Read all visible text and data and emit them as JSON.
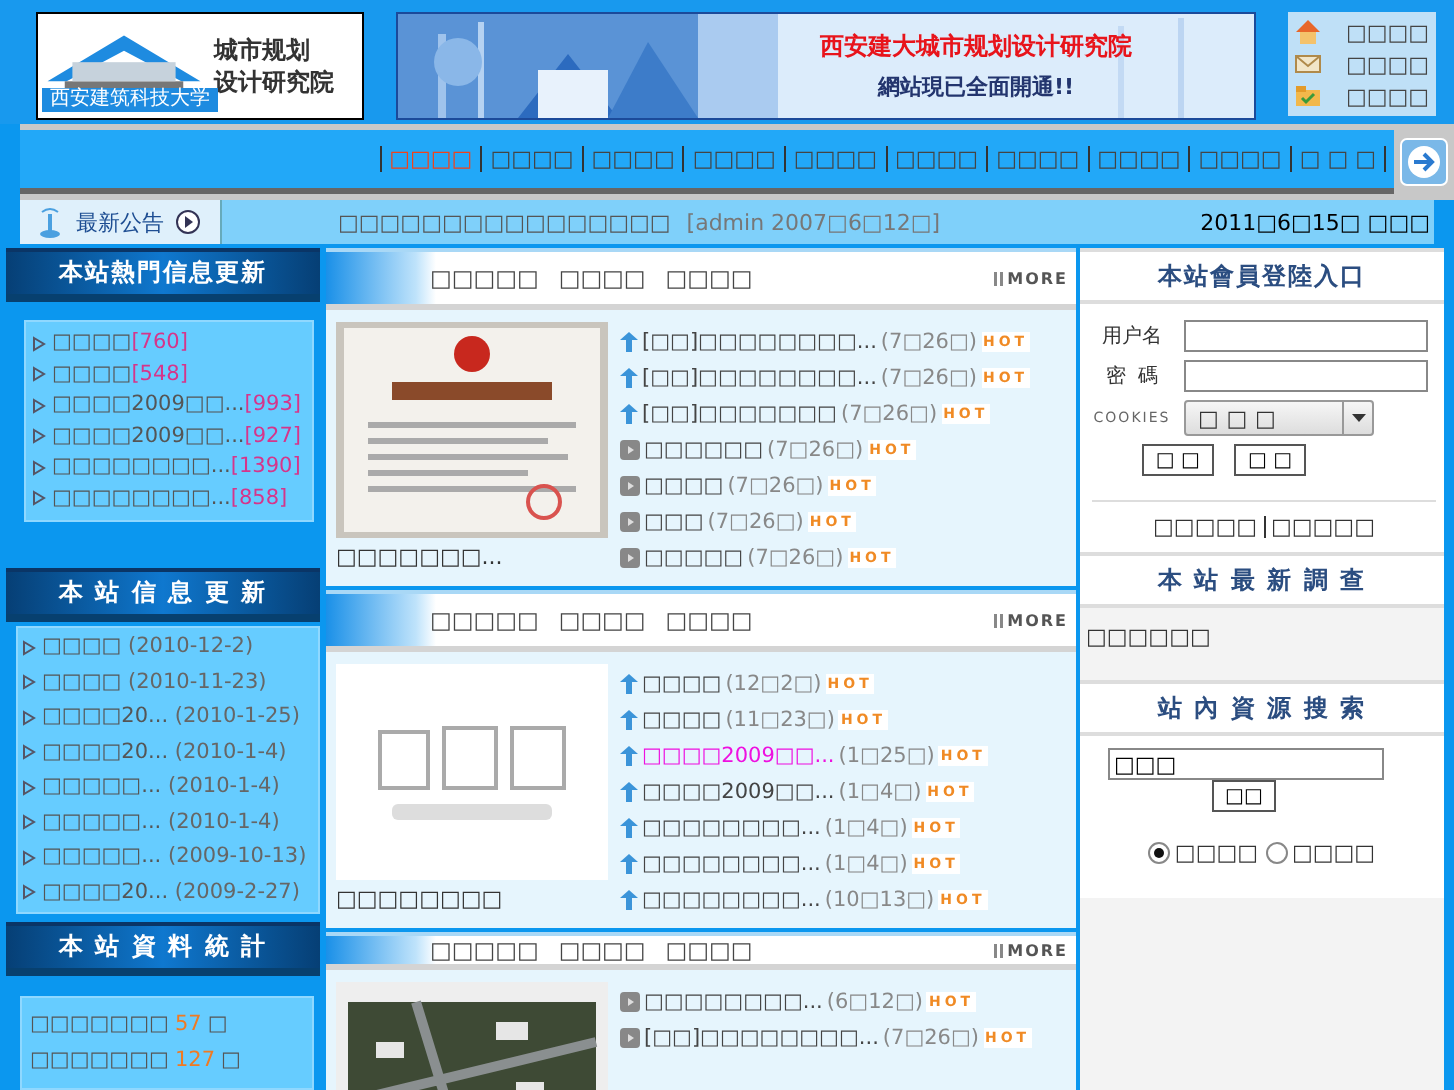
{
  "header": {
    "logo": {
      "title_line1": "城市规划",
      "title_line2": "设计研究院",
      "university": "西安建筑科技大学"
    },
    "banner": {
      "headline": "西安建大城市规划设计研究院",
      "subline": "網站現已全面開通!!"
    },
    "quick_links": [
      {
        "kind": "home",
        "label": "□□□□"
      },
      {
        "kind": "mail",
        "label": "□□□□"
      },
      {
        "kind": "bookmark",
        "label": "□□□□"
      }
    ]
  },
  "nav": {
    "items": [
      {
        "label": "□□□□",
        "selected": true
      },
      {
        "label": "□□□□",
        "selected": false
      },
      {
        "label": "□□□□",
        "selected": false
      },
      {
        "label": "□□□□",
        "selected": false
      },
      {
        "label": "□□□□",
        "selected": false
      },
      {
        "label": "□□□□",
        "selected": false
      },
      {
        "label": "□□□□",
        "selected": false
      },
      {
        "label": "□□□□",
        "selected": false
      },
      {
        "label": "□□□□",
        "selected": false
      },
      {
        "label": "□ □ □",
        "selected": false
      }
    ]
  },
  "notice": {
    "label": "最新公告",
    "text": "□□□□□□□□□□□□□□□□",
    "meta": "[admin  2007□6□12□]",
    "date": "2011□6□15□ □□□"
  },
  "sidebar": {
    "hot": {
      "title": "本站熱門信息更新",
      "items": [
        {
          "title": "□□□□",
          "count": "[760]"
        },
        {
          "title": "□□□□",
          "count": "[548]"
        },
        {
          "title": "□□□□2009□□...",
          "count": "[993]"
        },
        {
          "title": "□□□□2009□□...",
          "count": "[927]"
        },
        {
          "title": "□□□□□□□□...",
          "count": "[1390]"
        },
        {
          "title": "□□□□□□□□...",
          "count": "[858]"
        }
      ]
    },
    "updates": {
      "title": "本 站 信 息 更 新",
      "items": [
        {
          "title": "□□□□",
          "date": "(2010-12-2)"
        },
        {
          "title": "□□□□",
          "date": "(2010-11-23)"
        },
        {
          "title": "□□□□20...",
          "date": "(2010-1-25)"
        },
        {
          "title": "□□□□20...",
          "date": "(2010-1-4)"
        },
        {
          "title": "□□□□□...",
          "date": "(2010-1-4)"
        },
        {
          "title": "□□□□□...",
          "date": "(2010-1-4)"
        },
        {
          "title": "□□□□□...",
          "date": "(2009-10-13)"
        },
        {
          "title": "□□□□20...",
          "date": "(2009-2-27)"
        }
      ]
    },
    "stats": {
      "title": "本 站 資 料 統 計",
      "rows": [
        {
          "label": "□□□□□□□",
          "value": "57",
          "unit": "□"
        },
        {
          "label": "□□□□□□□",
          "value": "127",
          "unit": "□"
        }
      ]
    }
  },
  "panels": [
    {
      "tabs": [
        "□□□□□",
        "□□□□",
        "□□□□"
      ],
      "more": "MORE",
      "caption": "□□□□□□□...",
      "items": [
        {
          "kind": "up",
          "title": "[□□]□□□□□□□□...",
          "date": "(7□26□)",
          "tag": "HOT",
          "highlighted": false
        },
        {
          "kind": "up",
          "title": "[□□]□□□□□□□□...",
          "date": "(7□26□)",
          "tag": "HOT",
          "highlighted": false
        },
        {
          "kind": "up",
          "title": "[□□]□□□□□□□",
          "date": "(7□26□)",
          "tag": "HOT",
          "highlighted": false
        },
        {
          "kind": "square",
          "title": "□□□□□□",
          "date": "(7□26□)",
          "tag": "HOT",
          "highlighted": false
        },
        {
          "kind": "square",
          "title": "□□□□",
          "date": "(7□26□)",
          "tag": "HOT",
          "highlighted": false
        },
        {
          "kind": "square",
          "title": "□□□",
          "date": "(7□26□)",
          "tag": "HOT",
          "highlighted": false
        },
        {
          "kind": "square",
          "title": "□□□□□",
          "date": "(7□26□)",
          "tag": "HOT",
          "highlighted": false
        }
      ]
    },
    {
      "tabs": [
        "□□□□□",
        "□□□□",
        "□□□□"
      ],
      "more": "MORE",
      "caption": "□□□□□□□□",
      "items": [
        {
          "kind": "up",
          "title": "□□□□",
          "date": "(12□2□)",
          "tag": "HOT",
          "highlighted": false
        },
        {
          "kind": "up",
          "title": "□□□□",
          "date": "(11□23□)",
          "tag": "HOT",
          "highlighted": false
        },
        {
          "kind": "up",
          "title": "□□□□2009□□...",
          "date": "(1□25□)",
          "tag": "HOT",
          "highlighted": true
        },
        {
          "kind": "up",
          "title": "□□□□2009□□...",
          "date": "(1□4□)",
          "tag": "HOT",
          "highlighted": false
        },
        {
          "kind": "up",
          "title": "□□□□□□□□...",
          "date": "(1□4□)",
          "tag": "HOT",
          "highlighted": false
        },
        {
          "kind": "up",
          "title": "□□□□□□□□...",
          "date": "(1□4□)",
          "tag": "HOT",
          "highlighted": false
        },
        {
          "kind": "up",
          "title": "□□□□□□□□...",
          "date": "(10□13□)",
          "tag": "HOT",
          "highlighted": false
        }
      ]
    },
    {
      "tabs": [
        "□□□□□",
        "□□□□",
        "□□□□"
      ],
      "more": "MORE",
      "items": [
        {
          "kind": "square",
          "title": "□□□□□□□□...",
          "date": "(6□12□)",
          "tag": "HOT",
          "highlighted": false
        },
        {
          "kind": "square",
          "title": "[□□]□□□□□□□□...",
          "date": "(7□26□)",
          "tag": "HOT",
          "highlighted": false
        }
      ]
    }
  ],
  "member": {
    "login": {
      "title": "本站會員登陸入口",
      "fields": [
        {
          "label": "用户名"
        },
        {
          "label": "密  碼"
        }
      ],
      "cookies": {
        "label": "COOKIES",
        "value": "□ □ □"
      },
      "buttons": [
        "□ □",
        "□ □"
      ],
      "links": [
        "□□□□□",
        "□□□□□"
      ]
    },
    "poll": {
      "title": "本 站 最 新 調 查",
      "text": "□□□□□□"
    },
    "search": {
      "title": "站 內 資 源 搜 索",
      "value": "□□□",
      "button": "□□",
      "scopes": [
        {
          "label": "□□□□",
          "selected": true
        },
        {
          "label": "□□□□",
          "selected": false
        }
      ]
    }
  }
}
